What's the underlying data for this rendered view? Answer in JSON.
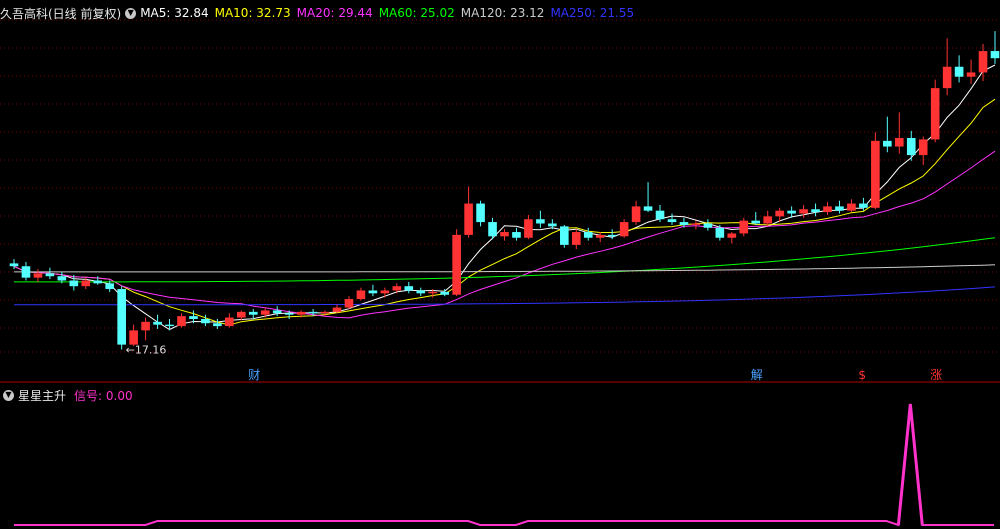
{
  "main": {
    "title": "久吾高科(日线 前复权)",
    "ma": [
      {
        "label": "MA5: 32.84",
        "color": "#ffffff"
      },
      {
        "label": "MA10: 32.73",
        "color": "#ffff00"
      },
      {
        "label": "MA20: 29.44",
        "color": "#ff33ff"
      },
      {
        "label": "MA60: 25.02",
        "color": "#00ff00"
      },
      {
        "label": "MA120: 23.12",
        "color": "#cccccc"
      },
      {
        "label": "MA250: 21.55",
        "color": "#3333ff"
      }
    ],
    "low_price_label": "17.16",
    "event_markers": [
      {
        "text": "财",
        "color": "#4aa3ff"
      },
      {
        "text": "解",
        "color": "#4aa3ff"
      },
      {
        "text": "$",
        "color": "#ff3333"
      },
      {
        "text": "涨",
        "color": "#ff3333"
      }
    ]
  },
  "sub": {
    "title": "星星主升",
    "signal_label": "信号: 0.00",
    "signal_color": "#ff33cc"
  },
  "colors": {
    "up": "#ff3333",
    "down": "#54ffff",
    "grid": "#7a0000",
    "separator": "#b00000"
  },
  "chart_data": {
    "type": "candlestick",
    "x": [
      1,
      2,
      3,
      4,
      5,
      6,
      7,
      8,
      9,
      10,
      11,
      12,
      13,
      14,
      15,
      16,
      17,
      18,
      19,
      20,
      21,
      22,
      23,
      24,
      25,
      26,
      27,
      28,
      29,
      30,
      31,
      32,
      33,
      34,
      35,
      36,
      37,
      38,
      39,
      40,
      41,
      42,
      43,
      44,
      45,
      46,
      47,
      48,
      49,
      50,
      51,
      52,
      53,
      54,
      55,
      56,
      57,
      58,
      59,
      60,
      61,
      62,
      63,
      64,
      65,
      66,
      67,
      68,
      69,
      70,
      71,
      72,
      73,
      74,
      75,
      76,
      77,
      78,
      79,
      80,
      81,
      82,
      83
    ],
    "ohlc": [
      [
        23.2,
        23.5,
        22.8,
        23.0
      ],
      [
        23.0,
        23.3,
        22.0,
        22.2
      ],
      [
        22.2,
        22.8,
        21.9,
        22.5
      ],
      [
        22.5,
        22.9,
        22.1,
        22.3
      ],
      [
        22.3,
        22.6,
        21.8,
        22.0
      ],
      [
        22.0,
        22.4,
        21.3,
        21.6
      ],
      [
        21.6,
        22.2,
        21.4,
        22.0
      ],
      [
        22.0,
        22.3,
        21.7,
        21.8
      ],
      [
        21.8,
        22.0,
        21.2,
        21.4
      ],
      [
        21.4,
        21.6,
        17.16,
        17.5
      ],
      [
        17.5,
        18.9,
        17.4,
        18.5
      ],
      [
        18.5,
        19.4,
        17.8,
        19.1
      ],
      [
        19.1,
        19.6,
        18.6,
        18.9
      ],
      [
        18.9,
        19.3,
        18.5,
        18.8
      ],
      [
        18.8,
        19.7,
        18.7,
        19.5
      ],
      [
        19.5,
        19.9,
        19.0,
        19.3
      ],
      [
        19.3,
        19.6,
        18.8,
        19.0
      ],
      [
        19.0,
        19.3,
        18.6,
        18.8
      ],
      [
        18.8,
        19.7,
        18.7,
        19.4
      ],
      [
        19.4,
        19.9,
        19.2,
        19.8
      ],
      [
        19.8,
        20.0,
        19.3,
        19.6
      ],
      [
        19.6,
        20.1,
        19.4,
        19.9
      ],
      [
        19.9,
        20.2,
        19.5,
        19.7
      ],
      [
        19.7,
        19.9,
        19.3,
        19.6
      ],
      [
        19.6,
        19.9,
        19.4,
        19.8
      ],
      [
        19.8,
        20.0,
        19.5,
        19.7
      ],
      [
        19.7,
        19.9,
        19.5,
        19.8
      ],
      [
        19.8,
        20.3,
        19.7,
        20.1
      ],
      [
        20.1,
        20.9,
        20.0,
        20.7
      ],
      [
        20.7,
        21.5,
        20.6,
        21.3
      ],
      [
        21.3,
        21.7,
        20.9,
        21.1
      ],
      [
        21.1,
        21.5,
        20.8,
        21.3
      ],
      [
        21.3,
        21.8,
        21.1,
        21.6
      ],
      [
        21.6,
        21.9,
        21.1,
        21.3
      ],
      [
        21.3,
        21.5,
        20.9,
        21.1
      ],
      [
        21.1,
        21.4,
        20.8,
        21.2
      ],
      [
        21.2,
        21.4,
        20.9,
        21.0
      ],
      [
        21.0,
        25.6,
        20.9,
        25.2
      ],
      [
        25.2,
        28.6,
        25.0,
        27.4
      ],
      [
        27.4,
        27.6,
        25.8,
        26.1
      ],
      [
        26.1,
        26.4,
        24.9,
        25.1
      ],
      [
        25.1,
        25.6,
        24.8,
        25.4
      ],
      [
        25.4,
        25.7,
        24.8,
        25.0
      ],
      [
        25.0,
        26.6,
        24.9,
        26.3
      ],
      [
        26.3,
        26.9,
        25.7,
        26.0
      ],
      [
        26.0,
        26.3,
        25.6,
        25.8
      ],
      [
        25.8,
        25.9,
        24.3,
        24.5
      ],
      [
        24.5,
        25.6,
        24.2,
        25.4
      ],
      [
        25.4,
        25.7,
        24.8,
        25.0
      ],
      [
        25.0,
        25.4,
        24.7,
        25.2
      ],
      [
        25.2,
        25.6,
        24.9,
        25.1
      ],
      [
        25.1,
        26.3,
        25.0,
        26.1
      ],
      [
        26.1,
        27.6,
        25.9,
        27.2
      ],
      [
        27.2,
        28.9,
        26.8,
        26.9
      ],
      [
        26.9,
        27.3,
        26.1,
        26.3
      ],
      [
        26.3,
        26.7,
        25.9,
        26.1
      ],
      [
        26.1,
        26.4,
        25.7,
        25.9
      ],
      [
        25.9,
        26.2,
        25.6,
        26.0
      ],
      [
        26.0,
        26.3,
        25.5,
        25.7
      ],
      [
        25.7,
        25.9,
        24.8,
        25.0
      ],
      [
        25.0,
        25.4,
        24.6,
        25.3
      ],
      [
        25.3,
        26.4,
        25.1,
        26.2
      ],
      [
        26.2,
        26.8,
        25.9,
        26.0
      ],
      [
        26.0,
        26.9,
        25.8,
        26.5
      ],
      [
        26.5,
        27.1,
        26.1,
        26.9
      ],
      [
        26.9,
        27.2,
        26.4,
        26.7
      ],
      [
        26.7,
        27.3,
        26.4,
        27.0
      ],
      [
        27.0,
        27.4,
        26.5,
        26.8
      ],
      [
        26.8,
        27.5,
        26.6,
        27.2
      ],
      [
        27.2,
        27.6,
        26.7,
        26.9
      ],
      [
        26.9,
        27.7,
        26.8,
        27.4
      ],
      [
        27.4,
        27.8,
        26.9,
        27.1
      ],
      [
        27.1,
        32.4,
        27.0,
        31.8
      ],
      [
        31.8,
        33.5,
        31.0,
        31.4
      ],
      [
        31.4,
        33.8,
        30.9,
        32.0
      ],
      [
        32.0,
        32.5,
        30.4,
        30.8
      ],
      [
        30.8,
        32.1,
        30.1,
        31.9
      ],
      [
        31.9,
        36.1,
        31.7,
        35.5
      ],
      [
        35.5,
        39.0,
        35.0,
        37.0
      ],
      [
        37.0,
        37.8,
        35.9,
        36.3
      ],
      [
        36.3,
        37.5,
        35.8,
        36.6
      ],
      [
        36.6,
        38.6,
        36.0,
        38.1
      ],
      [
        38.1,
        39.5,
        37.2,
        37.6
      ]
    ],
    "signal": [
      0,
      0,
      0,
      0,
      0,
      0,
      0,
      0,
      0,
      0,
      0,
      0,
      1,
      1,
      1,
      1,
      1,
      1,
      1,
      1,
      1,
      1,
      1,
      1,
      1,
      1,
      1,
      1,
      1,
      1,
      1,
      1,
      1,
      1,
      1,
      1,
      1,
      1,
      1,
      0,
      0,
      0,
      0,
      1,
      1,
      1,
      1,
      1,
      1,
      1,
      1,
      1,
      1,
      1,
      1,
      1,
      1,
      1,
      1,
      1,
      1,
      1,
      1,
      1,
      1,
      1,
      1,
      1,
      1,
      1,
      1,
      1,
      1,
      1,
      0,
      30,
      0,
      0,
      0,
      0,
      0,
      0,
      0
    ],
    "ylim": [
      16,
      40
    ],
    "grid": true
  }
}
